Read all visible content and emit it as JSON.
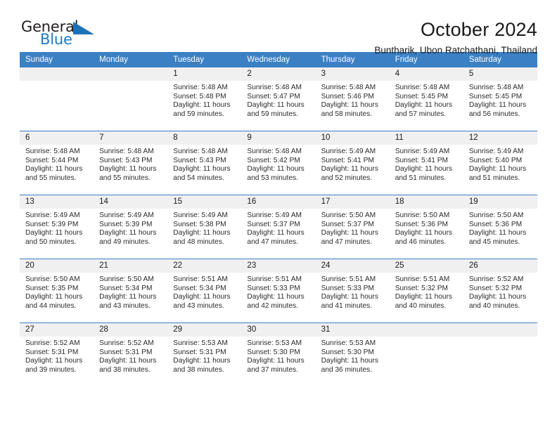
{
  "brand": {
    "name_top": "General",
    "name_bottom": "Blue",
    "accent_color": "#1c72b8",
    "dark_color": "#231f20"
  },
  "header": {
    "title": "October 2024",
    "subtitle": "Buntharik, Ubon Ratchathani, Thailand"
  },
  "theme": {
    "header_row_bg": "#3b80c4",
    "daynum_bg": "#f0f0f0",
    "divider": "#3b80c4"
  },
  "calendar": {
    "weekday_headers": [
      "Sunday",
      "Monday",
      "Tuesday",
      "Wednesday",
      "Thursday",
      "Friday",
      "Saturday"
    ],
    "weeks": [
      [
        {
          "day": "",
          "sunrise": "",
          "sunset": "",
          "daylight_line1": "",
          "daylight_line2": ""
        },
        {
          "day": "",
          "sunrise": "",
          "sunset": "",
          "daylight_line1": "",
          "daylight_line2": ""
        },
        {
          "day": "1",
          "sunrise": "Sunrise: 5:48 AM",
          "sunset": "Sunset: 5:48 PM",
          "daylight_line1": "Daylight: 11 hours",
          "daylight_line2": "and 59 minutes."
        },
        {
          "day": "2",
          "sunrise": "Sunrise: 5:48 AM",
          "sunset": "Sunset: 5:47 PM",
          "daylight_line1": "Daylight: 11 hours",
          "daylight_line2": "and 59 minutes."
        },
        {
          "day": "3",
          "sunrise": "Sunrise: 5:48 AM",
          "sunset": "Sunset: 5:46 PM",
          "daylight_line1": "Daylight: 11 hours",
          "daylight_line2": "and 58 minutes."
        },
        {
          "day": "4",
          "sunrise": "Sunrise: 5:48 AM",
          "sunset": "Sunset: 5:45 PM",
          "daylight_line1": "Daylight: 11 hours",
          "daylight_line2": "and 57 minutes."
        },
        {
          "day": "5",
          "sunrise": "Sunrise: 5:48 AM",
          "sunset": "Sunset: 5:45 PM",
          "daylight_line1": "Daylight: 11 hours",
          "daylight_line2": "and 56 minutes."
        }
      ],
      [
        {
          "day": "6",
          "sunrise": "Sunrise: 5:48 AM",
          "sunset": "Sunset: 5:44 PM",
          "daylight_line1": "Daylight: 11 hours",
          "daylight_line2": "and 55 minutes."
        },
        {
          "day": "7",
          "sunrise": "Sunrise: 5:48 AM",
          "sunset": "Sunset: 5:43 PM",
          "daylight_line1": "Daylight: 11 hours",
          "daylight_line2": "and 55 minutes."
        },
        {
          "day": "8",
          "sunrise": "Sunrise: 5:48 AM",
          "sunset": "Sunset: 5:43 PM",
          "daylight_line1": "Daylight: 11 hours",
          "daylight_line2": "and 54 minutes."
        },
        {
          "day": "9",
          "sunrise": "Sunrise: 5:48 AM",
          "sunset": "Sunset: 5:42 PM",
          "daylight_line1": "Daylight: 11 hours",
          "daylight_line2": "and 53 minutes."
        },
        {
          "day": "10",
          "sunrise": "Sunrise: 5:49 AM",
          "sunset": "Sunset: 5:41 PM",
          "daylight_line1": "Daylight: 11 hours",
          "daylight_line2": "and 52 minutes."
        },
        {
          "day": "11",
          "sunrise": "Sunrise: 5:49 AM",
          "sunset": "Sunset: 5:41 PM",
          "daylight_line1": "Daylight: 11 hours",
          "daylight_line2": "and 51 minutes."
        },
        {
          "day": "12",
          "sunrise": "Sunrise: 5:49 AM",
          "sunset": "Sunset: 5:40 PM",
          "daylight_line1": "Daylight: 11 hours",
          "daylight_line2": "and 51 minutes."
        }
      ],
      [
        {
          "day": "13",
          "sunrise": "Sunrise: 5:49 AM",
          "sunset": "Sunset: 5:39 PM",
          "daylight_line1": "Daylight: 11 hours",
          "daylight_line2": "and 50 minutes."
        },
        {
          "day": "14",
          "sunrise": "Sunrise: 5:49 AM",
          "sunset": "Sunset: 5:39 PM",
          "daylight_line1": "Daylight: 11 hours",
          "daylight_line2": "and 49 minutes."
        },
        {
          "day": "15",
          "sunrise": "Sunrise: 5:49 AM",
          "sunset": "Sunset: 5:38 PM",
          "daylight_line1": "Daylight: 11 hours",
          "daylight_line2": "and 48 minutes."
        },
        {
          "day": "16",
          "sunrise": "Sunrise: 5:49 AM",
          "sunset": "Sunset: 5:37 PM",
          "daylight_line1": "Daylight: 11 hours",
          "daylight_line2": "and 47 minutes."
        },
        {
          "day": "17",
          "sunrise": "Sunrise: 5:50 AM",
          "sunset": "Sunset: 5:37 PM",
          "daylight_line1": "Daylight: 11 hours",
          "daylight_line2": "and 47 minutes."
        },
        {
          "day": "18",
          "sunrise": "Sunrise: 5:50 AM",
          "sunset": "Sunset: 5:36 PM",
          "daylight_line1": "Daylight: 11 hours",
          "daylight_line2": "and 46 minutes."
        },
        {
          "day": "19",
          "sunrise": "Sunrise: 5:50 AM",
          "sunset": "Sunset: 5:36 PM",
          "daylight_line1": "Daylight: 11 hours",
          "daylight_line2": "and 45 minutes."
        }
      ],
      [
        {
          "day": "20",
          "sunrise": "Sunrise: 5:50 AM",
          "sunset": "Sunset: 5:35 PM",
          "daylight_line1": "Daylight: 11 hours",
          "daylight_line2": "and 44 minutes."
        },
        {
          "day": "21",
          "sunrise": "Sunrise: 5:50 AM",
          "sunset": "Sunset: 5:34 PM",
          "daylight_line1": "Daylight: 11 hours",
          "daylight_line2": "and 43 minutes."
        },
        {
          "day": "22",
          "sunrise": "Sunrise: 5:51 AM",
          "sunset": "Sunset: 5:34 PM",
          "daylight_line1": "Daylight: 11 hours",
          "daylight_line2": "and 43 minutes."
        },
        {
          "day": "23",
          "sunrise": "Sunrise: 5:51 AM",
          "sunset": "Sunset: 5:33 PM",
          "daylight_line1": "Daylight: 11 hours",
          "daylight_line2": "and 42 minutes."
        },
        {
          "day": "24",
          "sunrise": "Sunrise: 5:51 AM",
          "sunset": "Sunset: 5:33 PM",
          "daylight_line1": "Daylight: 11 hours",
          "daylight_line2": "and 41 minutes."
        },
        {
          "day": "25",
          "sunrise": "Sunrise: 5:51 AM",
          "sunset": "Sunset: 5:32 PM",
          "daylight_line1": "Daylight: 11 hours",
          "daylight_line2": "and 40 minutes."
        },
        {
          "day": "26",
          "sunrise": "Sunrise: 5:52 AM",
          "sunset": "Sunset: 5:32 PM",
          "daylight_line1": "Daylight: 11 hours",
          "daylight_line2": "and 40 minutes."
        }
      ],
      [
        {
          "day": "27",
          "sunrise": "Sunrise: 5:52 AM",
          "sunset": "Sunset: 5:31 PM",
          "daylight_line1": "Daylight: 11 hours",
          "daylight_line2": "and 39 minutes."
        },
        {
          "day": "28",
          "sunrise": "Sunrise: 5:52 AM",
          "sunset": "Sunset: 5:31 PM",
          "daylight_line1": "Daylight: 11 hours",
          "daylight_line2": "and 38 minutes."
        },
        {
          "day": "29",
          "sunrise": "Sunrise: 5:53 AM",
          "sunset": "Sunset: 5:31 PM",
          "daylight_line1": "Daylight: 11 hours",
          "daylight_line2": "and 38 minutes."
        },
        {
          "day": "30",
          "sunrise": "Sunrise: 5:53 AM",
          "sunset": "Sunset: 5:30 PM",
          "daylight_line1": "Daylight: 11 hours",
          "daylight_line2": "and 37 minutes."
        },
        {
          "day": "31",
          "sunrise": "Sunrise: 5:53 AM",
          "sunset": "Sunset: 5:30 PM",
          "daylight_line1": "Daylight: 11 hours",
          "daylight_line2": "and 36 minutes."
        },
        {
          "day": "",
          "sunrise": "",
          "sunset": "",
          "daylight_line1": "",
          "daylight_line2": ""
        },
        {
          "day": "",
          "sunrise": "",
          "sunset": "",
          "daylight_line1": "",
          "daylight_line2": ""
        }
      ]
    ]
  }
}
